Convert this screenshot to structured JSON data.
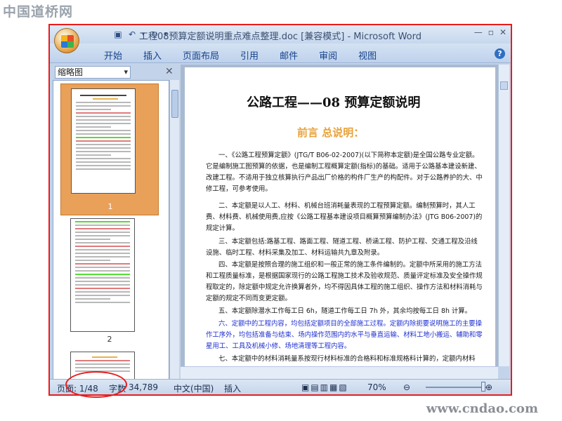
{
  "watermarks": {
    "top_left": "中国道桥网",
    "bottom_right": "www.cndao.com"
  },
  "window": {
    "title": "工程08预算定额说明重点难点整理.doc [兼容模式] - Microsoft Word",
    "controls": [
      "—",
      "▫",
      "✕"
    ]
  },
  "ribbon": {
    "tabs": [
      "开始",
      "插入",
      "页面布局",
      "引用",
      "邮件",
      "审阅",
      "视图"
    ]
  },
  "nav_pane": {
    "mode_label": "缩略图",
    "close": "✕",
    "pages": [
      "1",
      "2"
    ]
  },
  "document": {
    "title": "公路工程——08 预算定额说明",
    "subtitle": "前言  总说明：",
    "paragraphs": [
      "一、《公路工程预算定额》(JTG/T B06-02-2007)(以下简称本定额)是全国公路专业定额。它是编制施工图预算的依据，也是编制工程概算定额(指标)的基础。适用于公路基本建设新建、改建工程。不适用于独立核算执行产品出厂价格的构件厂生产的构配件。对于公路养护的大、中修工程，可参考使用。",
      "二、本定额是以人工、材料、机械台班消耗量表现的工程预算定额。编制预算时，其人工费、材料费、机械使用费,应按《公路工程基本建设项目概算预算编制办法》(JTG B06-2007)的规定计算。",
      "三、本定额包括:路基工程、路面工程、隧道工程、桥涵工程、防护工程、交通工程及沿线设施、临时工程、材料采集及加工、材料运输共九章及附录。",
      "四、本定额是按照合理的施工组织和一般正常的施工条件编制的。定额中所采用的施工方法和工程质量标准，是根据国家现行的公路工程施工技术及验收规范、质量评定标准及安全操作规程取定的，除定额中规定允许换算者外，均不得因具体工程的施工组织、操作方法和材料消耗与定额的规定不同而变更定额。",
      "五、本定额除潜水工作每工日 6h，隧道工作每工日 7h 外，其余均按每工日 8h 计算。",
      "六、定额中的工程内容，均包括定额项目的全部施工过程。定额内除扼要说明施工的主要操作工序外，均包括准备与结束、场内操作范围内的水平与垂直运输、材料工地小搬运、辅助和零星用工、工具及机械小修、场地清理等工程内容。",
      "七、本定额中的材料消耗量系按现行材料标准的合格料和标准规格料计算的，定额内材料"
    ]
  },
  "status_bar": {
    "page": "页面: 1/48",
    "words_label": "字数",
    "words": "34,789",
    "language": "中文(中国)",
    "mode": "插入",
    "zoom": "70%"
  },
  "colors": {
    "accent_frame": "#e81c1c",
    "subtitle": "#e8a23a",
    "link_text": "#1c2dcf"
  }
}
